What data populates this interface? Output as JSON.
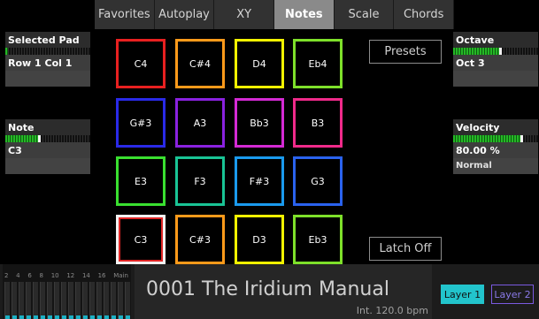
{
  "tabs": [
    {
      "label": "Favorites"
    },
    {
      "label": "Autoplay"
    },
    {
      "label": "XY"
    },
    {
      "label": "Notes",
      "active": true
    },
    {
      "label": "Scale"
    },
    {
      "label": "Chords"
    }
  ],
  "left_panel": {
    "selected_pad_label": "Selected Pad",
    "selected_pad_value": "Row 1 Col 1",
    "note_label": "Note",
    "note_value": "C3",
    "note_level": 0.4
  },
  "right_panel": {
    "octave_label": "Octave",
    "octave_value": "Oct 3",
    "octave_level": 0.55,
    "velocity_label": "Velocity",
    "velocity_value": "80.00 %",
    "velocity_level": 0.8,
    "velocity_mode": "Normal"
  },
  "pads": [
    {
      "note": "C4",
      "color": "#e82020"
    },
    {
      "note": "C#4",
      "color": "#ff9a1a"
    },
    {
      "note": "D4",
      "color": "#f2f200"
    },
    {
      "note": "Eb4",
      "color": "#7ee02a"
    },
    {
      "note": "G#3",
      "color": "#2a2ae8"
    },
    {
      "note": "A3",
      "color": "#8a22e0"
    },
    {
      "note": "Bb3",
      "color": "#d42ad4"
    },
    {
      "note": "B3",
      "color": "#f02a8a"
    },
    {
      "note": "E3",
      "color": "#3ae030"
    },
    {
      "note": "F3",
      "color": "#19c495"
    },
    {
      "note": "F#3",
      "color": "#1a9aee"
    },
    {
      "note": "G3",
      "color": "#2a62ee"
    },
    {
      "note": "C3",
      "color": "#e82020",
      "selected": true
    },
    {
      "note": "C#3",
      "color": "#ff9a1a"
    },
    {
      "note": "D3",
      "color": "#f2f200"
    },
    {
      "note": "Eb3",
      "color": "#7ee02a"
    }
  ],
  "presets_label": "Presets",
  "latch_label": "Latch Off",
  "mixer": {
    "labels": [
      "2",
      "4",
      "6",
      "8",
      "10",
      "12",
      "14",
      "16",
      "Main"
    ],
    "accent": "#1bb0c4"
  },
  "song": {
    "title": "0001 The Iridium Manual",
    "tempo": "Int. 120.0 bpm"
  },
  "layers": {
    "layer1": "Layer 1",
    "layer2": "Layer 2"
  }
}
